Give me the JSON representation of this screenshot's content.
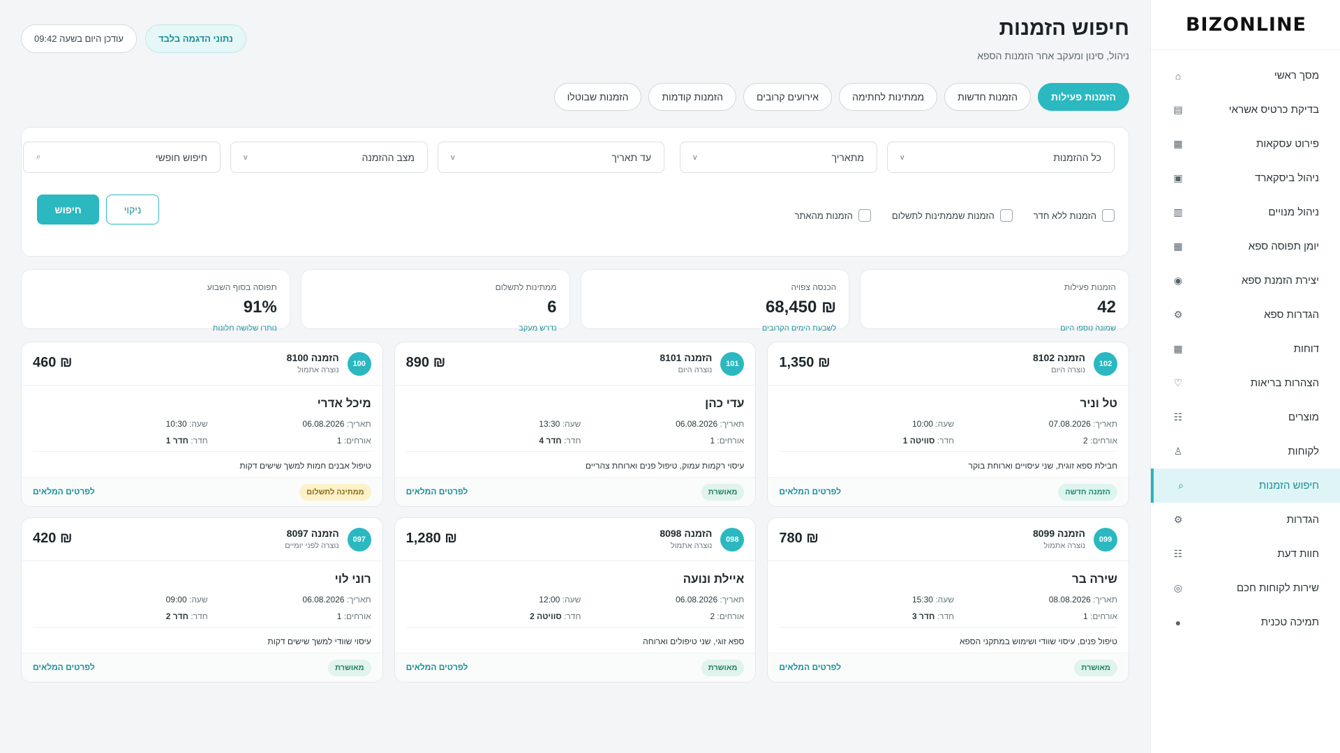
{
  "brand": "BIZONLINE",
  "nav": [
    {
      "label": "מסך ראשי",
      "icon": "home-icon",
      "glyph": "⌂"
    },
    {
      "label": "בדיקת כרטיס אשראי",
      "icon": "card-icon",
      "glyph": "▤"
    },
    {
      "label": "פירוט עסקאות",
      "icon": "table-icon",
      "glyph": "▦"
    },
    {
      "label": "ניהול ביסקארד",
      "icon": "bizcard-icon",
      "glyph": "▣"
    },
    {
      "label": "ניהול מנויים",
      "icon": "subscriptions-icon",
      "glyph": "▥"
    },
    {
      "label": "יומן תפוסה ספא",
      "icon": "calendar-icon",
      "glyph": "▦"
    },
    {
      "label": "יצירת הזמנת ספא",
      "icon": "create-icon",
      "glyph": "◉"
    },
    {
      "label": "הגדרות ספא",
      "icon": "spa-settings-icon",
      "glyph": "⚙"
    },
    {
      "label": "דוחות",
      "icon": "reports-icon",
      "glyph": "▦"
    },
    {
      "label": "הצהרות בריאות",
      "icon": "heart-icon",
      "glyph": "♡"
    },
    {
      "label": "מוצרים",
      "icon": "products-icon",
      "glyph": "☷"
    },
    {
      "label": "לקוחות",
      "icon": "customers-icon",
      "glyph": "♙"
    },
    {
      "label": "חיפוש הזמנות",
      "icon": "search-icon",
      "glyph": "⌕",
      "active": true
    },
    {
      "label": "הגדרות",
      "icon": "settings-icon",
      "glyph": "⚙"
    },
    {
      "label": "חוות דעת",
      "icon": "reviews-icon",
      "glyph": "☷"
    },
    {
      "label": "שירות לקוחות חכם",
      "icon": "support-icon",
      "glyph": "◎"
    },
    {
      "label": "תמיכה טכנית",
      "icon": "tech-support-icon",
      "glyph": "●"
    }
  ],
  "header": {
    "title": "חיפוש הזמנות",
    "subtitle": "ניהול, סינון ומעקב אחר הזמנות הספא",
    "demo_badge": "נתוני הדגמה בלבד",
    "updated": "עודכן היום בשעה 09:42"
  },
  "tabs": [
    "הזמנות פעילות",
    "הזמנות חדשות",
    "ממתינות לחתימה",
    "אירועים קרובים",
    "הזמנות קודמות",
    "הזמנות שבוטלו"
  ],
  "filters": {
    "all_orders": "כל ההזמנות",
    "from_date": "מתאריך",
    "to_date": "עד תאריך",
    "status": "מצב ההזמנה",
    "search_placeholder": "חיפוש חופשי",
    "chk_no_room": "הזמנות ללא חדר",
    "chk_pending_pay": "הזמנות שממתינות לתשלום",
    "chk_from_site": "הזמנות מהאתר",
    "search_btn": "חיפוש",
    "clear_btn": "ניקוי"
  },
  "stats": [
    {
      "title": "הזמנות פעילות",
      "value": "42",
      "note": "שמונה נוספו היום"
    },
    {
      "title": "הכנסה צפויה",
      "value": "₪ 68,450",
      "note": "לשבעת הימים הקרובים"
    },
    {
      "title": "ממתינות לתשלום",
      "value": "6",
      "note": "נדרש מעקב"
    },
    {
      "title": "תפוסה בסוף השבוע",
      "value": "91%",
      "note": "נותרו שלושה חלונות"
    }
  ],
  "labels": {
    "date": "תאריך:",
    "time": "שעה:",
    "guests": "אורחים:",
    "room": "חדר:",
    "details": "לפרטים המלאים"
  },
  "orders": [
    {
      "badge": "102",
      "title": "הזמנה 8102",
      "sub": "נוצרה היום",
      "price": "₪ 1,350",
      "name": "טל וניר",
      "date": "07.08.2026",
      "time": "10:00",
      "guests": "2",
      "room": "סוויטה 1",
      "desc": "חבילת ספא זוגית, שני עיסויים וארוחת בוקר",
      "status": "הזמנה חדשה",
      "st": "new"
    },
    {
      "badge": "101",
      "title": "הזמנה 8101",
      "sub": "נוצרה היום",
      "price": "₪ 890",
      "name": "עדי כהן",
      "date": "06.08.2026",
      "time": "13:30",
      "guests": "1",
      "room": "חדר 4",
      "desc": "עיסוי רקמות עמוק, טיפול פנים וארוחת צהריים",
      "status": "מאושרת",
      "st": "ok"
    },
    {
      "badge": "100",
      "title": "הזמנה 8100",
      "sub": "נוצרה אתמול",
      "price": "₪ 460",
      "name": "מיכל אדרי",
      "date": "06.08.2026",
      "time": "10:30",
      "guests": "1",
      "room": "חדר 1",
      "desc": "טיפול אבנים חמות למשך שישים דקות",
      "status": "ממתינה לתשלום",
      "st": "wait"
    },
    {
      "badge": "099",
      "title": "הזמנה 8099",
      "sub": "נוצרה אתמול",
      "price": "₪ 780",
      "name": "שירה בר",
      "date": "08.08.2026",
      "time": "15:30",
      "guests": "1",
      "room": "חדר 3",
      "desc": "טיפול פנים, עיסוי שוודי ושימוש במתקני הספא",
      "status": "מאושרת",
      "st": "ok"
    },
    {
      "badge": "098",
      "title": "הזמנה 8098",
      "sub": "נוצרה אתמול",
      "price": "₪ 1,280",
      "name": "איילת ונועה",
      "date": "06.08.2026",
      "time": "12:00",
      "guests": "2",
      "room": "סוויטה 2",
      "desc": "ספא זוגי, שני טיפולים וארוחה",
      "status": "מאושרת",
      "st": "ok"
    },
    {
      "badge": "097",
      "title": "הזמנה 8097",
      "sub": "נוצרה לפני יומיים",
      "price": "₪ 420",
      "name": "רוני לוי",
      "date": "06.08.2026",
      "time": "09:00",
      "guests": "1",
      "room": "חדר 2",
      "desc": "עיסוי שוודי למשך שישים דקות",
      "status": "מאושרת",
      "st": "ok"
    }
  ]
}
